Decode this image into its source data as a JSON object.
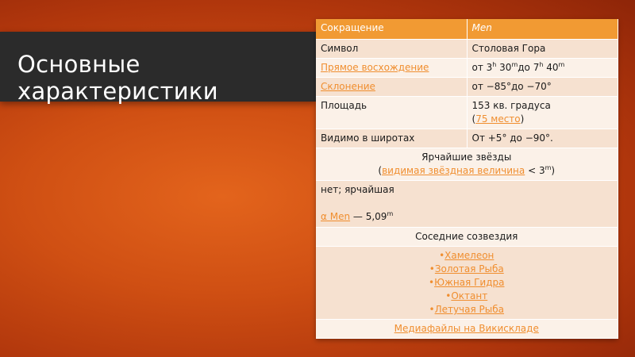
{
  "slide": {
    "title": "Основные характеристики"
  },
  "table": {
    "header": {
      "label": "Сокращение",
      "value": "Men"
    },
    "symbol": {
      "label": "Символ",
      "value": "Столовая Гора"
    },
    "ra": {
      "label": "Прямое восхождение",
      "prefix": "от 3",
      "h1": "h",
      "m1_val": " 30",
      "m1": "m",
      "mid": "до 7",
      "h2": "h",
      "m2_val": " 40",
      "m2": "m"
    },
    "dec": {
      "label": "Склонение",
      "value": "от −85°до −70°"
    },
    "area": {
      "label": "Площадь",
      "value": "153 кв. градуса",
      "open": "(",
      "rank": "75 место",
      "close": ")"
    },
    "latitudes": {
      "label": "Видимо в широтах",
      "value": "От +5° до −90°."
    },
    "brightest": {
      "title": "Ярчайшие звёзды",
      "open": "(",
      "link": "видимая звёздная величина",
      "rest": " < 3",
      "sup": "m",
      "close": ")"
    },
    "brightest_value": {
      "text": "нет; ярчайшая",
      "star": "α Men",
      "dash": " — 5,09",
      "sup": "m"
    },
    "neighbors": {
      "title": "Соседние созвездия",
      "items": [
        "Хамелеон",
        "Золотая Рыба",
        "Южная Гидра",
        "Октант",
        "Летучая Рыба"
      ]
    },
    "media": "Медиафайлы на Викискладе"
  }
}
